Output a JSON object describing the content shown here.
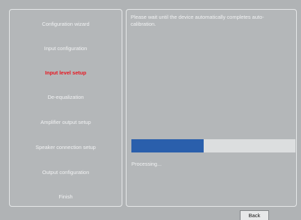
{
  "sidebar": {
    "steps": [
      {
        "label": "Configuration wizard",
        "active": false
      },
      {
        "label": "Input configuration",
        "active": false
      },
      {
        "label": "Input level setup",
        "active": true
      },
      {
        "label": "De-equalization",
        "active": false
      },
      {
        "label": "Amplifier output setup",
        "active": false
      },
      {
        "label": "Speaker connection setup",
        "active": false
      },
      {
        "label": "Output configuration",
        "active": false
      },
      {
        "label": "Finish",
        "active": false
      }
    ]
  },
  "main": {
    "message": "Please wait until the device automatically completes auto-calibration.",
    "progress": {
      "fraction": 0.44,
      "status_text": "Processing...",
      "fill_color": "#2a5fac"
    }
  },
  "footer": {
    "back_label": "Back"
  },
  "colors": {
    "active_step": "#e8151f",
    "text": "#f2f3f4",
    "background": "#b0b3b5"
  }
}
